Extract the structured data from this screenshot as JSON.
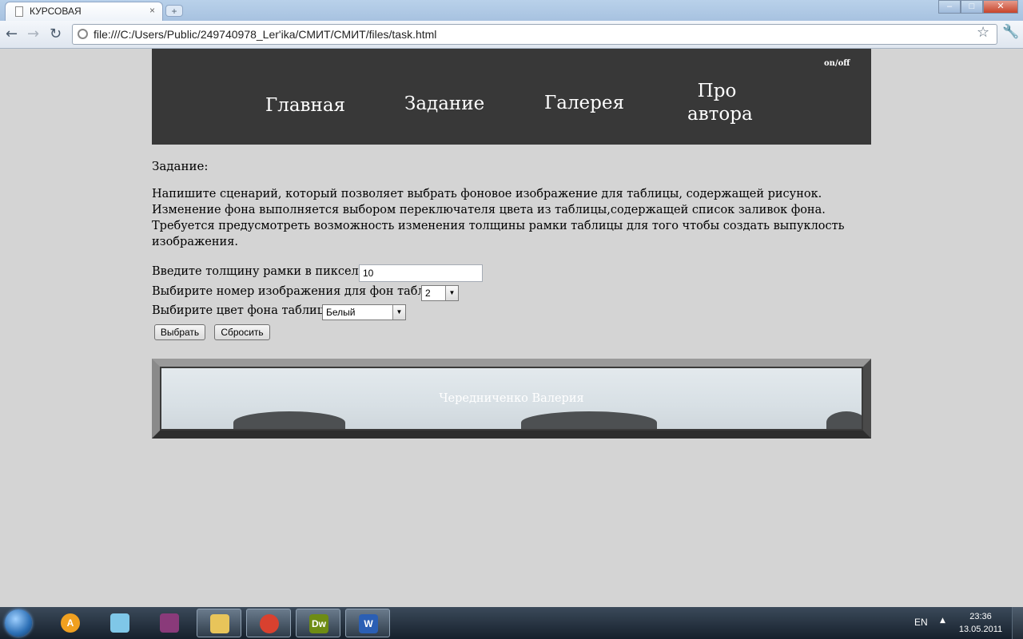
{
  "browser": {
    "tab_title": "КУРСОВАЯ",
    "tab_close": "×",
    "new_tab": "+",
    "url": "file:///C:/Users/Public/249740978_Ler'ika/СМИТ/СМИТ/files/task.html",
    "window_buttons": {
      "minimize": "–",
      "maximize": "□",
      "close": "✕"
    }
  },
  "header": {
    "toggle_label": "on/off",
    "nav": [
      {
        "label": "Главная"
      },
      {
        "label": "Задание"
      },
      {
        "label": "Галерея"
      },
      {
        "label": "Про автора"
      }
    ]
  },
  "task": {
    "heading": "Задание:",
    "text": "Напишите сценарий, который позволяет выбрать фоновое изображение для таблицы, содержащей рисунок. Изменение фона выполняется выбором переключателя цвета из таблицы,содержащей список заливок фона. Требуется предусмотреть возможность изменения толщины рамки таблицы для того чтобы создать выпуклость изображения."
  },
  "form": {
    "border_label": "Введите толщину рамки в пикселях:",
    "border_value": "10",
    "image_label": "Выбирите номер изображения для фон таблицы:",
    "image_selected": "2",
    "color_label": "Выбирите цвет фона таблицы:",
    "color_selected": "Белый",
    "submit_label": "Выбрать",
    "reset_label": "Сбросить"
  },
  "preview": {
    "caption": "Чередниченко Валерия"
  },
  "taskbar": {
    "language": "EN",
    "time": "23:36",
    "date": "13.05.2011",
    "apps": [
      {
        "name": "aimp",
        "glyph": "A",
        "color": "#f0a020"
      },
      {
        "name": "notes",
        "glyph": "",
        "color": "#7fc7e8"
      },
      {
        "name": "winrar",
        "glyph": "",
        "color": "#8a3a7a"
      },
      {
        "name": "explorer",
        "glyph": "",
        "color": "#e8c45a"
      },
      {
        "name": "chrome",
        "glyph": "",
        "color": "#d9412f"
      },
      {
        "name": "dreamweaver",
        "glyph": "Dw",
        "color": "#6e8c14"
      },
      {
        "name": "word",
        "glyph": "W",
        "color": "#2b5fb4"
      }
    ]
  }
}
